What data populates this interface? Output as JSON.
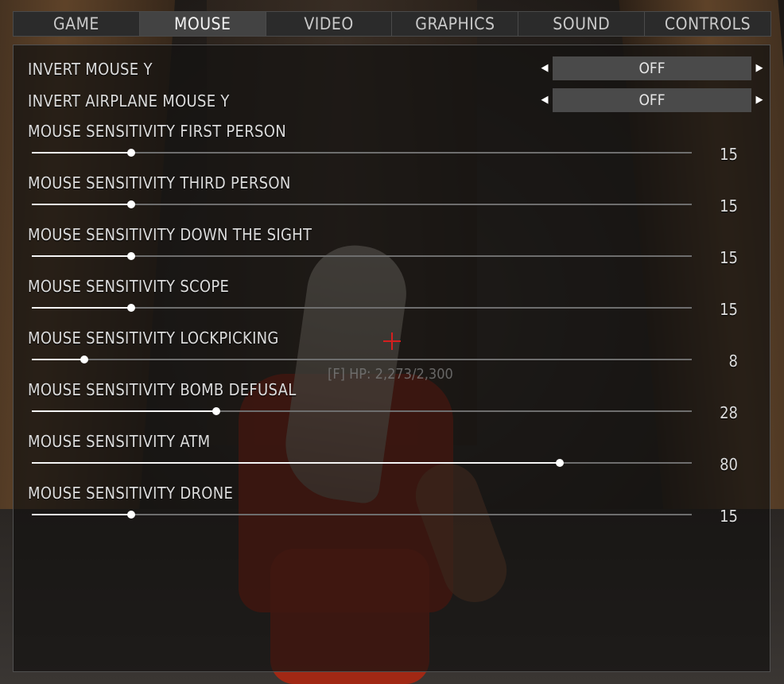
{
  "tabs": [
    {
      "label": "GAME",
      "active": false
    },
    {
      "label": "MOUSE",
      "active": true
    },
    {
      "label": "VIDEO",
      "active": false
    },
    {
      "label": "GRAPHICS",
      "active": false
    },
    {
      "label": "SOUND",
      "active": false
    },
    {
      "label": "CONTROLS",
      "active": false
    }
  ],
  "toggles": [
    {
      "label": "INVERT MOUSE Y",
      "value": "OFF"
    },
    {
      "label": "INVERT AIRPLANE MOUSE Y",
      "value": "OFF"
    }
  ],
  "sliders": [
    {
      "label": "MOUSE SENSITIVITY FIRST PERSON",
      "value": "15",
      "level": 0.15
    },
    {
      "label": "MOUSE SENSITIVITY THIRD PERSON",
      "value": "15",
      "level": 0.15
    },
    {
      "label": "MOUSE SENSITIVITY DOWN THE SIGHT",
      "value": "15",
      "level": 0.15
    },
    {
      "label": "MOUSE SENSITIVITY SCOPE",
      "value": "15",
      "level": 0.15
    },
    {
      "label": "MOUSE SENSITIVITY LOCKPICKING",
      "value": "8",
      "level": 0.08
    },
    {
      "label": "MOUSE SENSITIVITY BOMB DEFUSAL",
      "value": "28",
      "level": 0.28
    },
    {
      "label": "MOUSE SENSITIVITY ATM",
      "value": "80",
      "level": 0.8
    },
    {
      "label": "MOUSE SENSITIVITY DRONE",
      "value": "15",
      "level": 0.15
    }
  ],
  "hud": {
    "text": "[F] HP: 2,273/2,300"
  },
  "icons": {
    "arrow_left": "◀",
    "arrow_right": "▶"
  },
  "colors": {
    "accent_fill": "#f4f4f4",
    "track": "#6e6e6e",
    "crosshair": "#d51e1e"
  }
}
